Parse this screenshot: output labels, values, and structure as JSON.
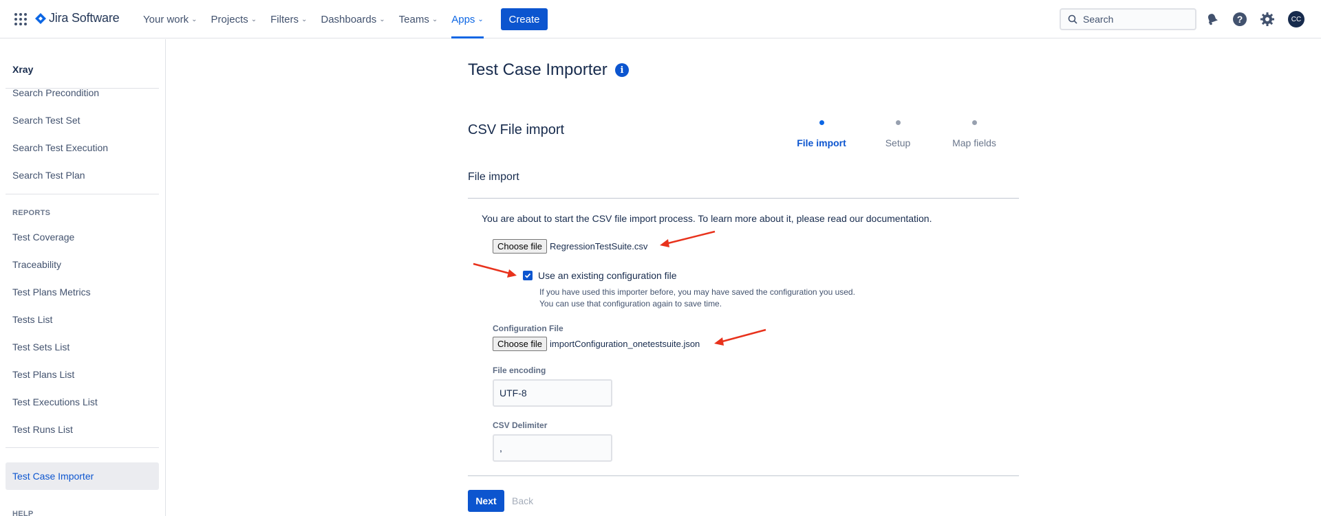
{
  "topnav": {
    "product": "Jira Software",
    "menu": [
      {
        "label": "Your work",
        "active": false
      },
      {
        "label": "Projects",
        "active": false
      },
      {
        "label": "Filters",
        "active": false
      },
      {
        "label": "Dashboards",
        "active": false
      },
      {
        "label": "Teams",
        "active": false
      },
      {
        "label": "Apps",
        "active": true
      }
    ],
    "create_label": "Create",
    "search_placeholder": "Search",
    "avatar_initials": "CC",
    "icons": [
      "notifications-icon",
      "help-icon",
      "settings-icon"
    ]
  },
  "sidebar": {
    "title": "Xray",
    "items_top": [
      "Search Precondition",
      "Search Test Set",
      "Search Test Execution",
      "Search Test Plan"
    ],
    "reports_heading": "REPORTS",
    "reports": [
      "Test Coverage",
      "Traceability",
      "Test Plans Metrics",
      "Tests List",
      "Test Sets List",
      "Test Plans List",
      "Test Executions List",
      "Test Runs List"
    ],
    "active_item": "Test Case Importer",
    "help_heading": "HELP"
  },
  "main": {
    "title": "Test Case Importer",
    "section_title": "CSV File import",
    "steps": [
      {
        "label": "File import",
        "active": true
      },
      {
        "label": "Setup",
        "active": false
      },
      {
        "label": "Map fields",
        "active": false
      }
    ],
    "subtitle": "File import",
    "intro": "You are about to start the CSV file import process. To learn more about it, please read our documentation.",
    "choose_file_label": "Choose file",
    "csv_file_name": "RegressionTestSuite.csv",
    "use_config_label": "Use an existing configuration file",
    "use_config_checked": true,
    "help_text": "If you have used this importer before, you may have saved the configuration you used. You can use that configuration again to save time.",
    "config_file_label": "Configuration File",
    "config_file_name": "importConfiguration_onetestsuite.json",
    "encoding_label": "File encoding",
    "encoding_value": "UTF-8",
    "delimiter_label": "CSV Delimiter",
    "delimiter_value": ",",
    "next_label": "Next",
    "back_label": "Back"
  },
  "colors": {
    "primary": "#0c55cf",
    "annotation_arrow": "#e8321c"
  }
}
